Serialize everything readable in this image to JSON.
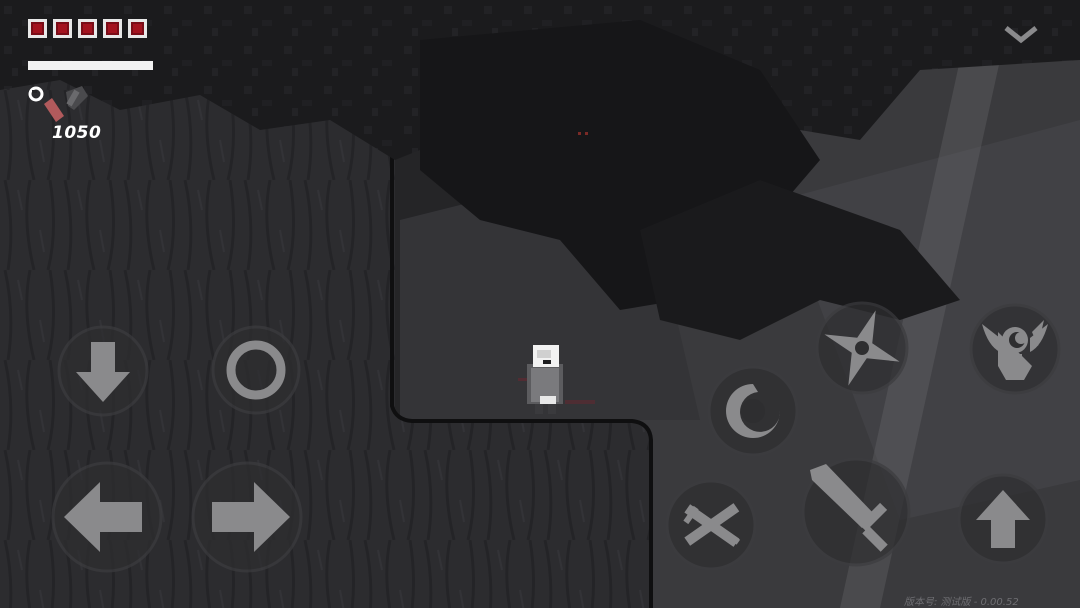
{
  "hud": {
    "hearts_total": 5,
    "hearts_filled": 5,
    "stamina_fraction": 1.0,
    "item_icon": "grapple-hook-icon",
    "ammo_count": "1050"
  },
  "controls": {
    "move_down": "down-arrow-icon",
    "move_left": "left-arrow-icon",
    "move_right": "right-arrow-icon",
    "interact": "ring-icon",
    "dodge": "swirl-icon",
    "throw": "shuriken-icon",
    "special": "crest-icon",
    "parry": "crossed-swords-icon",
    "attack": "sword-icon",
    "jump": "up-arrow-icon",
    "menu": "chevron-down-icon"
  },
  "version_text": "版本号: 测试版 - 0.00.52",
  "colors": {
    "heart": "#a3131f",
    "stamina": "#f2f2f2",
    "button_fill": "#8a8a8c"
  }
}
